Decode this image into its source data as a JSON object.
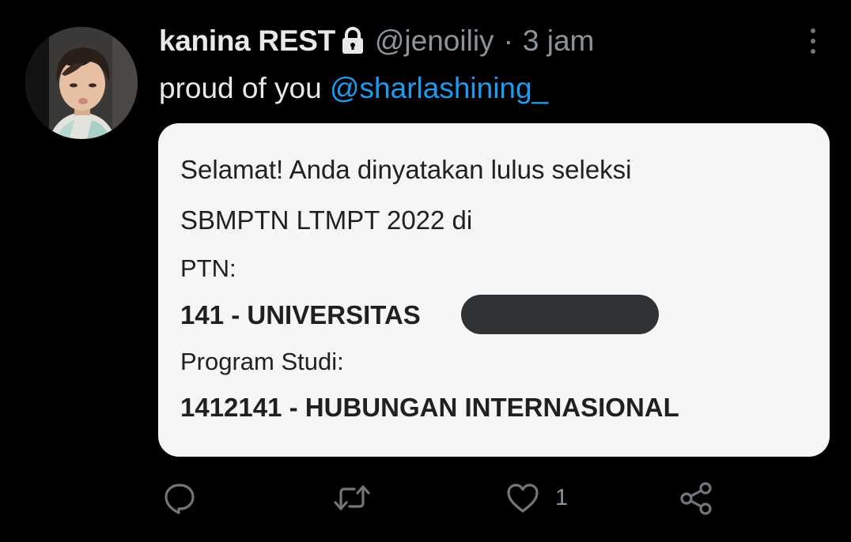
{
  "tweet": {
    "author": {
      "display_name": "kanina REST",
      "handle": "@jenoiliy",
      "separator": "·",
      "time": "3 jam",
      "protected_icon": "lock-icon"
    },
    "text": "proud of you ",
    "mention": "@sharlashining_",
    "media_text": {
      "line1": "Selamat! Anda dinyatakan lulus seleksi",
      "line2": "SBMPTN LTMPT 2022 di",
      "line3": "PTN:",
      "line4": "141 - UNIVERSITAS",
      "line5": "Program Studi:",
      "line6": "1412141 - HUBUNGAN INTERNASIONAL"
    },
    "actions": {
      "reply_icon": "reply-icon",
      "retweet_icon": "retweet-icon",
      "like_icon": "heart-icon",
      "like_count": "1",
      "share_icon": "share-icon"
    }
  },
  "colors": {
    "background": "#000000",
    "text": "#e7e9ea",
    "secondary": "#71767b",
    "link": "#1d9bf0",
    "card": "#f6f6f6"
  }
}
